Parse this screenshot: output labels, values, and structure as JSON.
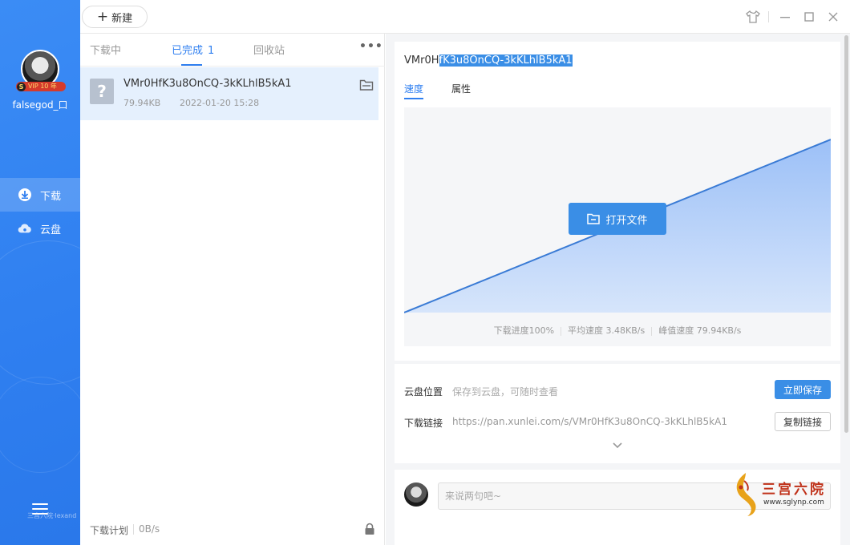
{
  "colors": {
    "sidebar": "#2f7ff0",
    "accent": "#3a8ee6",
    "selected_row": "#e5f0fd"
  },
  "sidebar": {
    "username": "falsegod_口",
    "vip_badge": "VIP 10 年",
    "nav": [
      {
        "label": "下载",
        "icon": "download-icon",
        "active": true
      },
      {
        "label": "云盘",
        "icon": "cloud-icon",
        "active": false
      }
    ],
    "watermark": "三宫六院·lexand"
  },
  "toolbar": {
    "new_label": "新建"
  },
  "list": {
    "tabs": [
      {
        "label": "下载中"
      },
      {
        "label": "已完成",
        "count": "1"
      },
      {
        "label": "回收站"
      }
    ],
    "items": [
      {
        "name": "VMr0HfK3u8OnCQ-3kKLhlB5kA1",
        "size": "79.94KB",
        "date": "2022-01-20 15:28"
      }
    ],
    "footer": {
      "plan_label": "下载计划",
      "speed": "0B/s"
    }
  },
  "detail": {
    "title_plain": "VMr0H",
    "title_selected": "fK3u8OnCQ-3kKLhlB5kA1",
    "tabs": [
      "速度",
      "属性"
    ],
    "open_file_label": "打开文件",
    "stats": {
      "progress": "下载进度100%",
      "avg_speed": "平均速度 3.48KB/s",
      "peak_speed": "峰值速度 79.94KB/s"
    },
    "cloud_label": "云盘位置",
    "cloud_hint": "保存到云盘，可随时查看",
    "save_button": "立即保存",
    "link_label": "下载链接",
    "link_url": "https://pan.xunlei.com/s/VMr0HfK3u8OnCQ-3kKLhlB5kA1",
    "copy_button": "复制链接",
    "comment_placeholder": "来说两句吧~"
  },
  "watermark_right": {
    "text": "三宫六院",
    "url": "www.sglynp.com"
  }
}
